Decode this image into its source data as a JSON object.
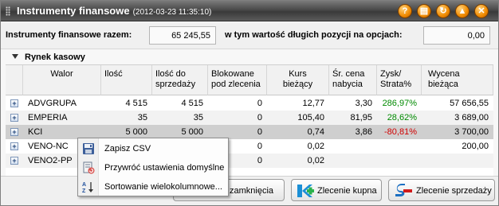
{
  "window": {
    "title": "Instrumenty finansowe",
    "timestamp": "(2012-03-23 11:35:10)",
    "title_buttons": [
      {
        "name": "help-button",
        "glyph": "?"
      },
      {
        "name": "print-button",
        "glyph": "▤"
      },
      {
        "name": "refresh-button",
        "glyph": "↻"
      },
      {
        "name": "minimize-button",
        "glyph": "▲"
      },
      {
        "name": "close-button",
        "glyph": "✕"
      }
    ]
  },
  "summary": {
    "total_label": "Instrumenty finansowe razem:",
    "total_value": "65 245,55",
    "options_label": "w tym wartość długich pozycji na opcjach:",
    "options_value": "0,00"
  },
  "section": {
    "label": "Rynek kasowy"
  },
  "table": {
    "headers": {
      "walor": "Walor",
      "ilosc": "Ilość",
      "ilosc_sprzedazy_1": "Ilość do",
      "ilosc_sprzedazy_2": "sprzedaży",
      "blokowane_1": "Blokowane",
      "blokowane_2": "pod zlecenia",
      "kurs_1": "Kurs",
      "kurs_2": "bieżący",
      "cena_1": "Śr. cena",
      "cena_2": "nabycia",
      "zysk_1": "Zysk/",
      "zysk_2": "Strata%",
      "wycena_1": "Wycena",
      "wycena_2": "bieżąca"
    },
    "expand_glyph": "+",
    "rows": [
      {
        "walor": "ADVGRUPA",
        "ilosc": "4 515",
        "ilosc_sprzedazy": "4 515",
        "blokowane": "0",
        "kurs": "12,77",
        "cena": "3,30",
        "zysk": "286,97%",
        "zysk_sign": "pos",
        "wycena": "57 656,55"
      },
      {
        "walor": "EMPERIA",
        "ilosc": "35",
        "ilosc_sprzedazy": "35",
        "blokowane": "0",
        "kurs": "105,40",
        "cena": "81,95",
        "zysk": "28,62%",
        "zysk_sign": "pos",
        "wycena": "3 689,00"
      },
      {
        "walor": "KCI",
        "ilosc": "5 000",
        "ilosc_sprzedazy": "5 000",
        "blokowane": "0",
        "kurs": "0,74",
        "cena": "3,86",
        "zysk": "-80,81%",
        "zysk_sign": "neg",
        "wycena": "3 700,00"
      },
      {
        "walor": "VENO-NC",
        "ilosc": "",
        "ilosc_sprzedazy": "",
        "blokowane": "0",
        "kurs": "0,02",
        "cena": "",
        "zysk": "",
        "zysk_sign": "",
        "wycena": "200,00"
      },
      {
        "walor": "VENO2-PP",
        "ilosc": "",
        "ilosc_sprzedazy": "",
        "blokowane": "0",
        "kurs": "0,02",
        "cena": "",
        "zysk": "",
        "zysk_sign": "",
        "wycena": ""
      }
    ]
  },
  "footer": {
    "close_partial_label": "zamknięcia",
    "buy_label": "Zlecenie kupna",
    "sell_label": "Zlecenie sprzedaży"
  },
  "context_menu": {
    "items": [
      {
        "label": "Zapisz CSV",
        "icon": "save-icon"
      },
      {
        "label": "Przywróć ustawienia domyślne",
        "icon": "restore-defaults-icon"
      },
      {
        "label": "Sortowanie wielokolumnowe...",
        "icon": "sort-icon"
      }
    ]
  },
  "colors": {
    "profit": "#008a00",
    "loss": "#d00000",
    "title_button": "#f08a00",
    "buy_icon": "#1b8fd6",
    "sell_icon": "#d11b1b"
  }
}
